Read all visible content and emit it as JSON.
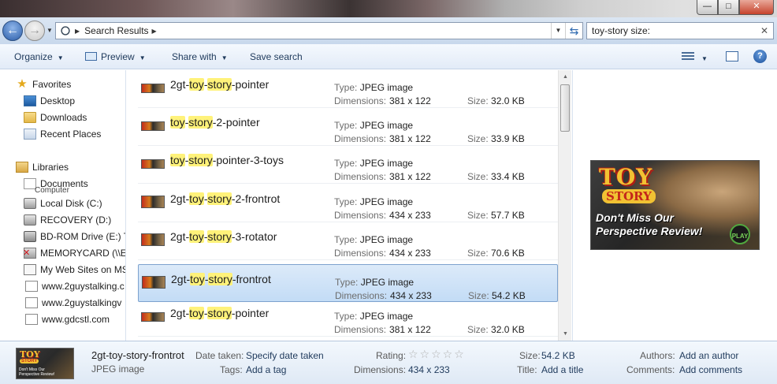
{
  "window": {
    "minimize": "—",
    "maximize": "□",
    "close": "✕"
  },
  "address": {
    "back_icon": "←",
    "forward_icon": "→",
    "path": "Search Results",
    "search_value": "toy-story size:",
    "search_clear": "✕"
  },
  "toolbar": {
    "organize": "Organize",
    "preview": "Preview",
    "share_with": "Share with",
    "save_search": "Save search",
    "help": "?"
  },
  "sidebar": {
    "favorites": "Favorites",
    "desktop": "Desktop",
    "downloads": "Downloads",
    "recent_places": "Recent Places",
    "libraries": "Libraries",
    "documents": "Documents",
    "computer_overlap": "Computer",
    "local_disk": "Local Disk (C:)",
    "recovery": "RECOVERY (D:)",
    "bd_rom": "BD-ROM Drive (E:) T",
    "memorycard": "MEMORYCARD (\\\\E",
    "my_web_sites": "My Web Sites on MS",
    "site1": "www.2guystalking.c",
    "site2": "www.2guystalkingv",
    "site3": "www.gdcstl.com"
  },
  "files": {
    "type_label": "Type:",
    "dim_label": "Dimensions:",
    "size_label": "Size:",
    "items": [
      {
        "pre": "2gt-",
        "hl1": "toy",
        "mid": "-",
        "hl2": "story",
        "post": "-pointer",
        "type": "JPEG image",
        "dims": "381 x 122",
        "size": "32.0 KB"
      },
      {
        "pre": "",
        "hl1": "toy",
        "mid": "-",
        "hl2": "story",
        "post": "-2-pointer",
        "type": "JPEG image",
        "dims": "381 x 122",
        "size": "33.9 KB"
      },
      {
        "pre": "",
        "hl1": "toy",
        "mid": "-",
        "hl2": "story",
        "post": "-pointer-3-toys",
        "type": "JPEG image",
        "dims": "381 x 122",
        "size": "33.4 KB"
      },
      {
        "pre": "2gt-",
        "hl1": "toy",
        "mid": "-",
        "hl2": "story",
        "post": "-2-frontrot",
        "type": "JPEG image",
        "dims": "434 x 233",
        "size": "57.7 KB"
      },
      {
        "pre": "2gt-",
        "hl1": "toy",
        "mid": "-",
        "hl2": "story",
        "post": "-3-rotator",
        "type": "JPEG image",
        "dims": "434 x 233",
        "size": "70.6 KB"
      },
      {
        "pre": "2gt-",
        "hl1": "toy",
        "mid": "-",
        "hl2": "story",
        "post": "-frontrot",
        "type": "JPEG image",
        "dims": "434 x 233",
        "size": "54.2 KB"
      },
      {
        "pre": "2gt-",
        "hl1": "toy",
        "mid": "-",
        "hl2": "story",
        "post": "-pointer",
        "type": "JPEG image",
        "dims": "381 x 122",
        "size": "32.0 KB"
      }
    ]
  },
  "preview": {
    "logo_toy": "TOY",
    "logo_story": "STORY",
    "tagline": "Don't Miss Our Perspective Review!",
    "play": "PLAY"
  },
  "details": {
    "thumb_toy": "TOY",
    "thumb_story": "STORY",
    "thumb_tagline": "Don't Miss Our Perspective Review!",
    "name": "2gt-toy-story-frontrot",
    "type": "JPEG image",
    "date_taken_label": "Date taken:",
    "date_taken_value": "Specify date taken",
    "tags_label": "Tags:",
    "tags_value": "Add a tag",
    "rating_label": "Rating:",
    "rating_stars": "☆☆☆☆☆",
    "rating_value": 0,
    "dimensions_label": "Dimensions:",
    "dimensions_value": "434 x 233",
    "size_label": "Size:",
    "size_value": "54.2 KB",
    "title_label": "Title:",
    "title_value": "Add a title",
    "authors_label": "Authors:",
    "authors_value": "Add an author",
    "comments_label": "Comments:",
    "comments_value": "Add comments"
  }
}
